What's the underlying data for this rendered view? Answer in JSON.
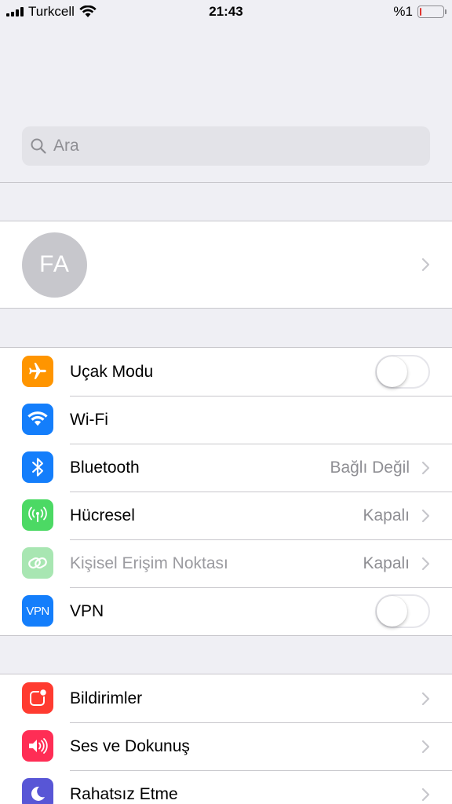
{
  "status_bar": {
    "carrier": "Turkcell",
    "time": "21:43",
    "battery_text": "%1",
    "battery_level": 0.06
  },
  "search": {
    "placeholder": "Ara",
    "value": ""
  },
  "profile": {
    "initials": "FA"
  },
  "colors": {
    "airplane": "#ff9500",
    "wifi": "#147efb",
    "bluetooth": "#147efb",
    "cellular": "#4cd964",
    "hotspot": "#a8e6b2",
    "vpn": "#147efb",
    "notifications": "#ff3b30",
    "sounds": "#ff2d55",
    "dnd": "#5856d6"
  },
  "connectivity": {
    "airplane": {
      "label": "Uçak Modu",
      "icon": "airplane-icon",
      "toggle_on": false
    },
    "wifi": {
      "label": "Wi-Fi",
      "icon": "wifi-icon"
    },
    "bluetooth": {
      "label": "Bluetooth",
      "value": "Bağlı Değil",
      "icon": "bluetooth-icon"
    },
    "cellular": {
      "label": "Hücresel",
      "value": "Kapalı",
      "icon": "cellular-icon"
    },
    "hotspot": {
      "label": "Kişisel Erişim Noktası",
      "value": "Kapalı",
      "icon": "hotspot-icon"
    },
    "vpn": {
      "label": "VPN",
      "icon_text": "VPN",
      "toggle_on": false
    }
  },
  "general": {
    "notifications": {
      "label": "Bildirimler",
      "icon": "notifications-icon"
    },
    "sounds": {
      "label": "Ses ve Dokunuş",
      "icon": "speaker-icon"
    },
    "dnd": {
      "label": "Rahatsız Etme",
      "icon": "moon-icon"
    }
  }
}
